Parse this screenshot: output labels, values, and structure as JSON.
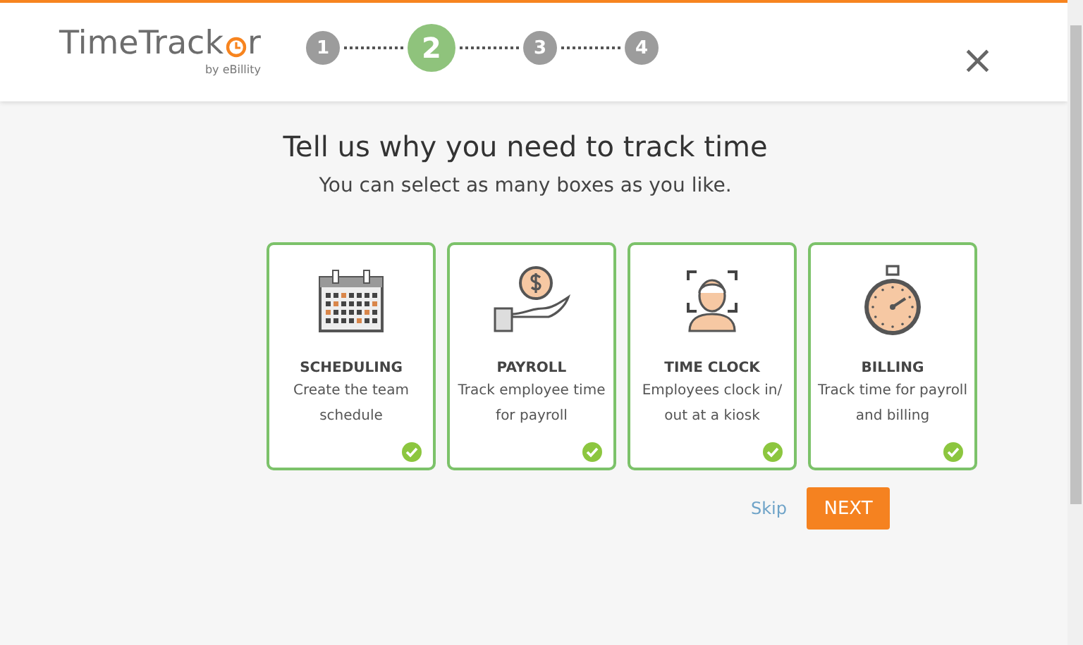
{
  "header": {
    "logo": {
      "before": "TimeTrack",
      "after": "r",
      "byline": "by eBillity"
    },
    "steps": [
      {
        "label": "1",
        "selected": false
      },
      {
        "label": "2",
        "selected": true
      },
      {
        "label": "3",
        "selected": false
      },
      {
        "label": "4",
        "selected": false
      }
    ],
    "close": "×"
  },
  "title": "Tell us why you need to track time",
  "subtitle": "You can select as many boxes as you like.",
  "options": [
    {
      "kind": "calendar",
      "title": "SCHEDULING",
      "description": "Create the team schedule",
      "selected": true
    },
    {
      "kind": "payroll",
      "title": "PAYROLL",
      "description": "Track employee time for payroll",
      "selected": true
    },
    {
      "kind": "face",
      "title": "TIME CLOCK",
      "description": "Employees clock in/ out at a kiosk",
      "selected": true
    },
    {
      "kind": "stopwatch",
      "title": "BILLING",
      "description": "Track time for payroll and billing",
      "selected": true
    }
  ],
  "actions": {
    "skip": "Skip",
    "next": "NEXT"
  }
}
